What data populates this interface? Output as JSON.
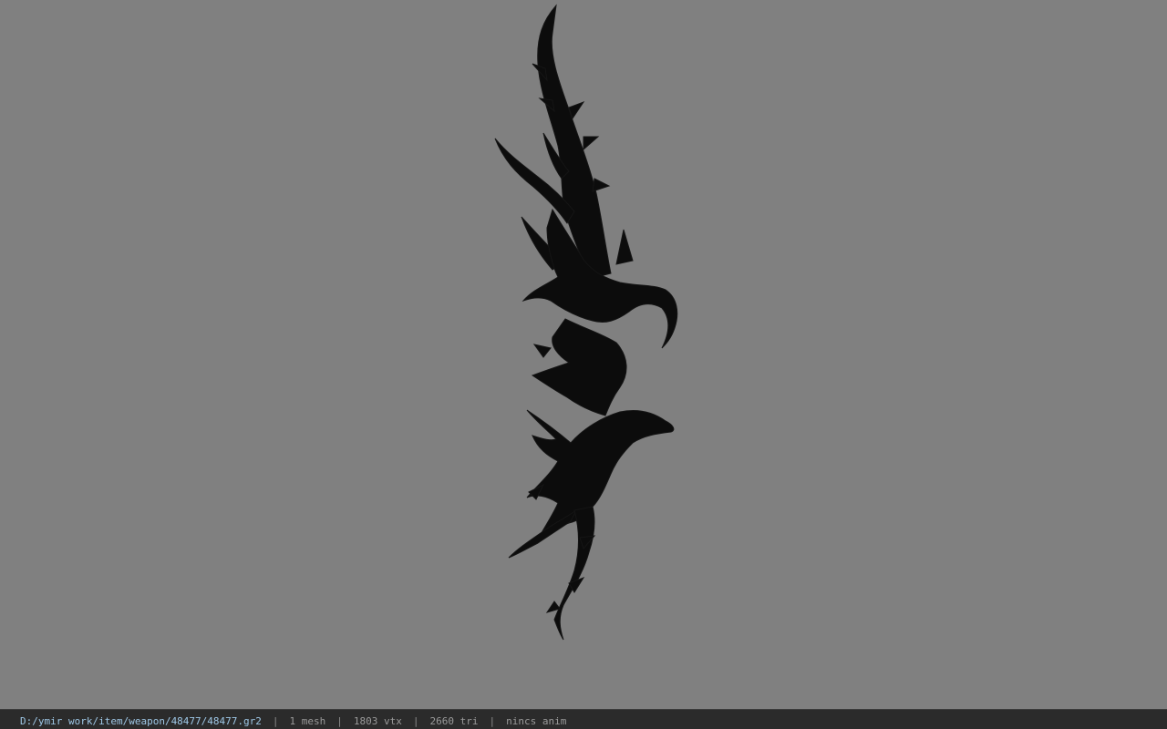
{
  "viewer": {
    "background_color": "#808080",
    "model_color": "#0c0c0c",
    "model_subject": "dark spiked wing-shaped weapon model"
  },
  "status": {
    "file_path": "D:/ymir work/item/weapon/48477/48477.gr2",
    "meshes": "1 mesh",
    "vertices": "1803 vtx",
    "triangles": "2660 tri",
    "animation": "nincs anim",
    "separator": "|"
  }
}
